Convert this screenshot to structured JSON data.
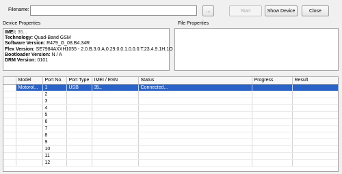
{
  "toolbar": {
    "filename_label": "Filename:",
    "filename_value": "",
    "browse_label": "...",
    "start_label": "Start",
    "show_device_label": "Show Device",
    "close_label": "Close"
  },
  "device_properties": {
    "title": "Device Properties",
    "imei_label": "IMEI:",
    "imei_value": "35...",
    "technology_label": "Technology:",
    "technology_value": "Quad-Band GSM",
    "software_label": "Software Version:",
    "software_value": "R479_G_08.B4.34R",
    "flex_label": "Flex Version:",
    "flex_value": "SE7984AXXH1055 - 2.0.B.3.0.A:0.29.0.0.1.0.0.0.T.23.4.9.1H.1O",
    "bootloader_label": "Bootloader Version:",
    "bootloader_value": "N / A",
    "drm_label": "DRM Version:",
    "drm_value": "0101"
  },
  "file_properties": {
    "title": "File Properties"
  },
  "grid": {
    "columns": [
      "Model",
      "Port No.",
      "Port Type",
      "IMEI / ESN",
      "Status",
      "Progress",
      "Result"
    ],
    "selected_row": {
      "model": "Motorol...",
      "port": "1",
      "type": "USB",
      "imei": "35...",
      "status": "Connected...",
      "progress": "",
      "result": ""
    },
    "port_numbers": [
      "2",
      "3",
      "4",
      "5",
      "6",
      "7",
      "8",
      "9",
      "10",
      "11",
      "12"
    ]
  },
  "colors": {
    "selection": "#2a63c8",
    "background": "#f0f0f0"
  }
}
